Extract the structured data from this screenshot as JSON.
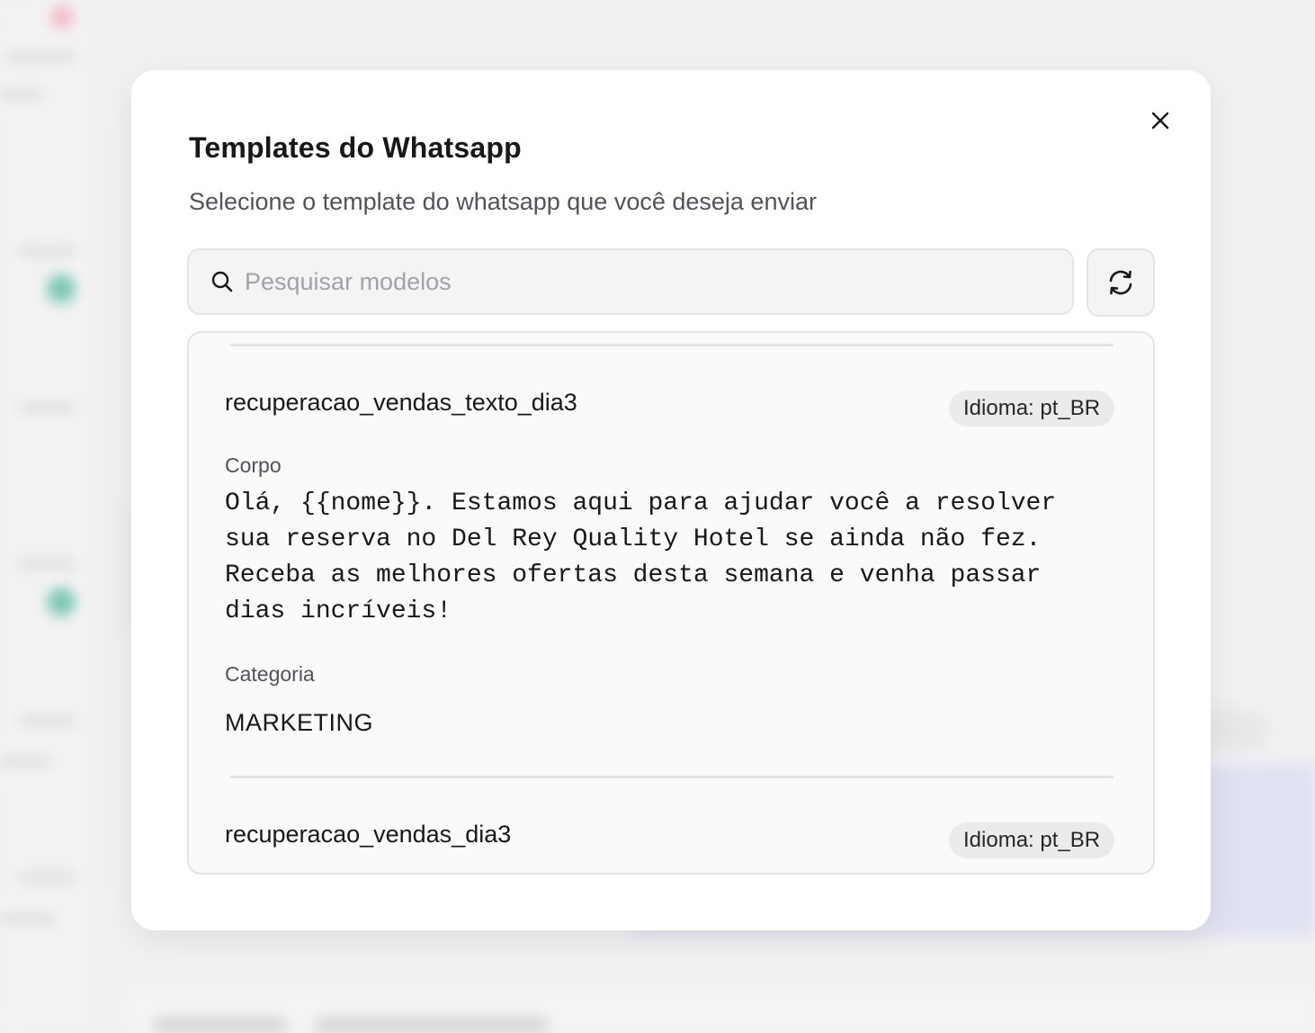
{
  "modal": {
    "title": "Templates do Whatsapp",
    "subtitle": "Selecione o template do whatsapp que você deseja enviar",
    "close_icon": "close-icon"
  },
  "search": {
    "placeholder": "Pesquisar modelos",
    "value": "",
    "icon": "search-icon"
  },
  "refresh": {
    "icon": "refresh-icon"
  },
  "templates": [
    {
      "name": "recuperacao_vendas_texto_dia3",
      "language_badge": "Idioma: pt_BR",
      "body_label": "Corpo",
      "body": "Olá, {{nome}}. Estamos aqui para ajudar você a resolver sua reserva no Del Rey Quality Hotel se ainda não fez. Receba as melhores ofertas desta semana e venha passar dias incríveis!",
      "category_label": "Categoria",
      "category": "MARKETING"
    },
    {
      "name": "recuperacao_vendas_dia3",
      "language_badge": "Idioma: pt_BR"
    }
  ],
  "colors": {
    "accent_dot": "#40b496",
    "backdrop": "#f1f1f2",
    "modal_bg": "#ffffff"
  }
}
